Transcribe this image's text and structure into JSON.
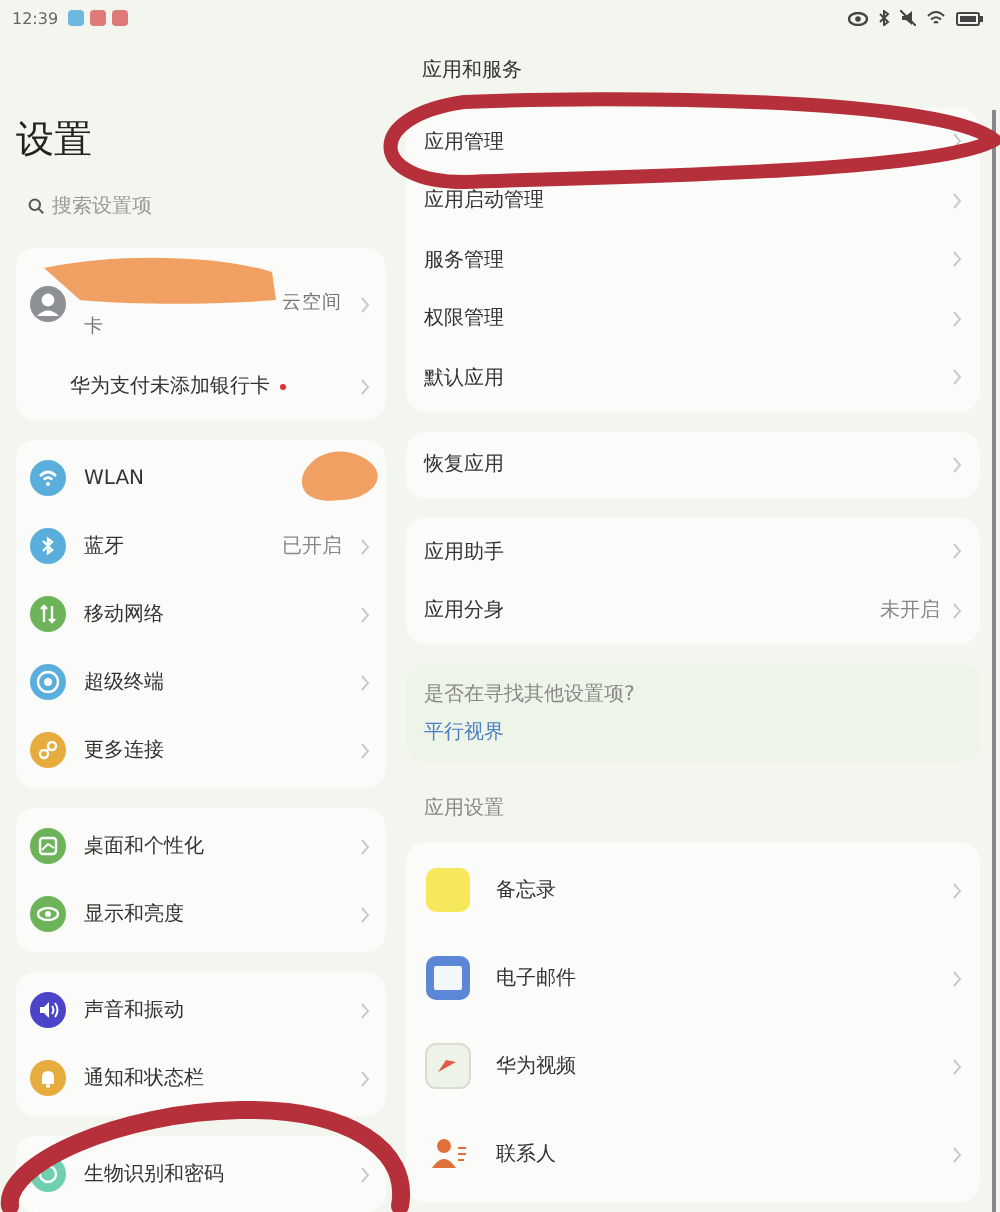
{
  "status_bar": {
    "time": "12:39"
  },
  "sidebar": {
    "title": "设置",
    "search": {
      "placeholder": "搜索设置项"
    },
    "groups": [
      [
        {
          "kind": "account",
          "label_1": "云空间",
          "label_2": "卡"
        },
        {
          "kind": "plain",
          "label": "华为支付未添加银行卡",
          "badge": true
        }
      ],
      [
        {
          "kind": "icon",
          "label": "WLAN"
        },
        {
          "kind": "icon",
          "label": "蓝牙",
          "value": "已开启"
        },
        {
          "kind": "icon",
          "label": "移动网络"
        },
        {
          "kind": "icon",
          "label": "超级终端"
        },
        {
          "kind": "icon",
          "label": "更多连接"
        }
      ],
      [
        {
          "kind": "icon",
          "label": "桌面和个性化"
        },
        {
          "kind": "icon",
          "label": "显示和亮度"
        }
      ],
      [
        {
          "kind": "icon",
          "label": "声音和振动"
        },
        {
          "kind": "icon",
          "label": "通知和状态栏"
        }
      ],
      [
        {
          "kind": "icon",
          "label": "生物识别和密码"
        }
      ]
    ]
  },
  "content": {
    "title": "应用和服务",
    "groups": [
      [
        {
          "label": "应用管理"
        },
        {
          "label": "应用启动管理"
        },
        {
          "label": "服务管理"
        },
        {
          "label": "权限管理"
        },
        {
          "label": "默认应用"
        }
      ],
      [
        {
          "label": "恢复应用"
        }
      ],
      [
        {
          "label": "应用助手"
        },
        {
          "label": "应用分身",
          "value": "未开启"
        }
      ]
    ],
    "suggestion": {
      "text": "是否在寻找其他设置项?",
      "link": "平行视界"
    },
    "section_title": "应用设置",
    "apps": [
      {
        "label": "备忘录"
      },
      {
        "label": "电子邮件"
      },
      {
        "label": "华为视频"
      },
      {
        "label": "联系人"
      }
    ]
  }
}
